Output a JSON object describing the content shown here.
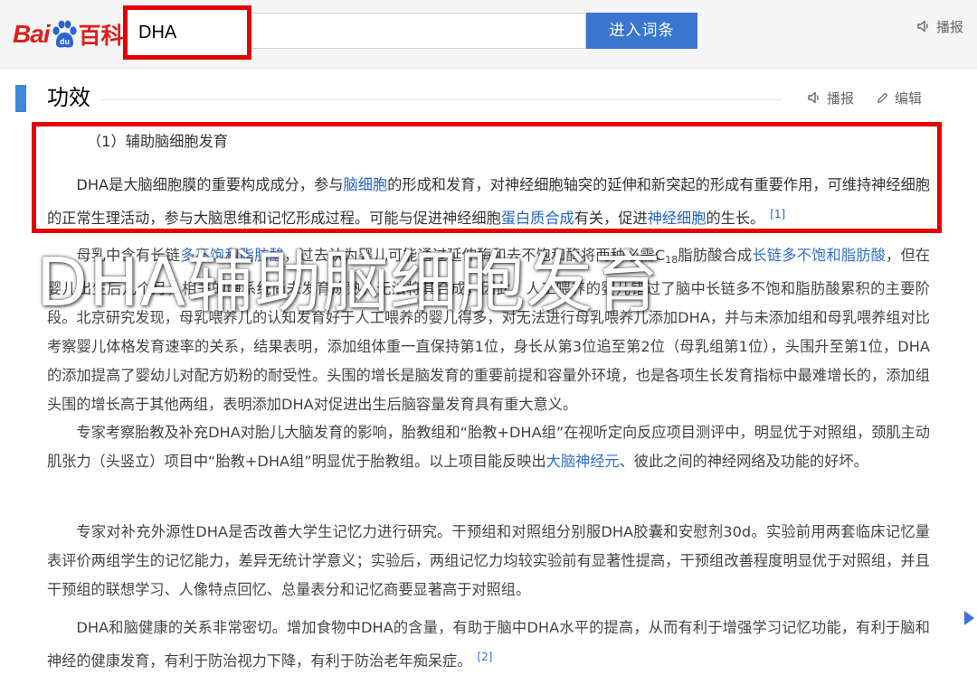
{
  "header": {
    "logo": {
      "text_a": "Bai",
      "text_b": "百科"
    },
    "search": {
      "value": "DHA"
    },
    "search_button": "进入词条",
    "play_label": "播报"
  },
  "section": {
    "title": "功效",
    "play_label": "播报",
    "edit_label": "编辑"
  },
  "content": {
    "subheading": "（1）辅助脑细胞发育",
    "p1": {
      "t1": "DHA是大脑细胞膜的重要构成成分，参与",
      "l1": "脑细胞",
      "t2": "的形成和发育，对神经细胞轴突的延伸和新突起的形成有重要作用，可维持神经细胞的正常生理活动，参与大脑思维和记忆形成过程。可能与促进神经细胞",
      "l2": "蛋白质合成",
      "t3": "有关，促进",
      "l3": "神经细胞",
      "t4": "的生长。",
      "ref": "[1]"
    },
    "p2": {
      "t1": "母乳中含有长链",
      "l1": "多不饱和脂肪酸",
      "t2": "，过去认为婴儿可能通过延伸酶和去不饱和酶将两种必需C",
      "sub": "18",
      "t3": "脂肪酸合成",
      "l2": "长链多不饱和脂肪酸",
      "t4": "，但在婴儿出生后几个月，相关的酶系统尚未发育成熟，无法将其合成，因此，人工喂养的婴儿错过了脑中长链多不饱和脂肪酸累积的主要阶段。北京研究发现，母乳喂养儿的认知发育好于人工喂养的婴儿得多，对无法进行母乳喂养儿添加DHA，并与未添加组和母乳喂养组对比考察婴儿体格发育速率的关系，结果表明，添加组体重一直保持第1位，身长从第3位追至第2位（母乳组第1位），头围升至第1位，DHA的添加提高了婴幼儿对配方奶粉的耐受性。头围的增长是脑发育的重要前提和容量外环境，也是各项生长发育指标中最难增长的，添加组头围的增长高于其他两组，表明添加DHA对促进出生后脑容量发育具有重大意义。"
    },
    "p3": {
      "t1": "专家考察胎教及补充DHA对胎儿大脑发育的影响，胎教组和“胎教+DHA组”在视听定向反应项目测评中，明显优于对照组，颈肌主动肌张力（头竖立）项目中“胎教+DHA组”明显优于胎教组。以上项目能反映出",
      "l1": "大脑神经元",
      "t2": "、彼此之间的神经网络及功能的好坏。"
    },
    "p4": "专家对补充外源性DHA是否改善大学生记忆力进行研究。干预组和对照组分别服DHA胶囊和安慰剂30d。实验前用两套临床记忆量表评价两组学生的记忆能力，差异无统计学意义；实验后，两组记忆力均较实验前有显著性提高，干预组改善程度明显优于对照组，并且干预组的联想学习、人像特点回忆、总量表分和记忆商要显著高于对照组。",
    "p5": {
      "text": "DHA和脑健康的关系非常密切。增加食物中DHA的含量，有助于脑中DHA水平的提高，从而有利于增强学习记忆功能，有利于脑和神经的健康发育，有利于防治视力下降，有利于防治老年痴呆症。",
      "ref": "[2]"
    }
  },
  "overlay": {
    "title": "DHA辅助脑细胞发育"
  },
  "colors": {
    "highlight": "#e30000",
    "link": "#1f63c6",
    "button": "#3a76d0",
    "section_mark": "#3f86dc"
  }
}
